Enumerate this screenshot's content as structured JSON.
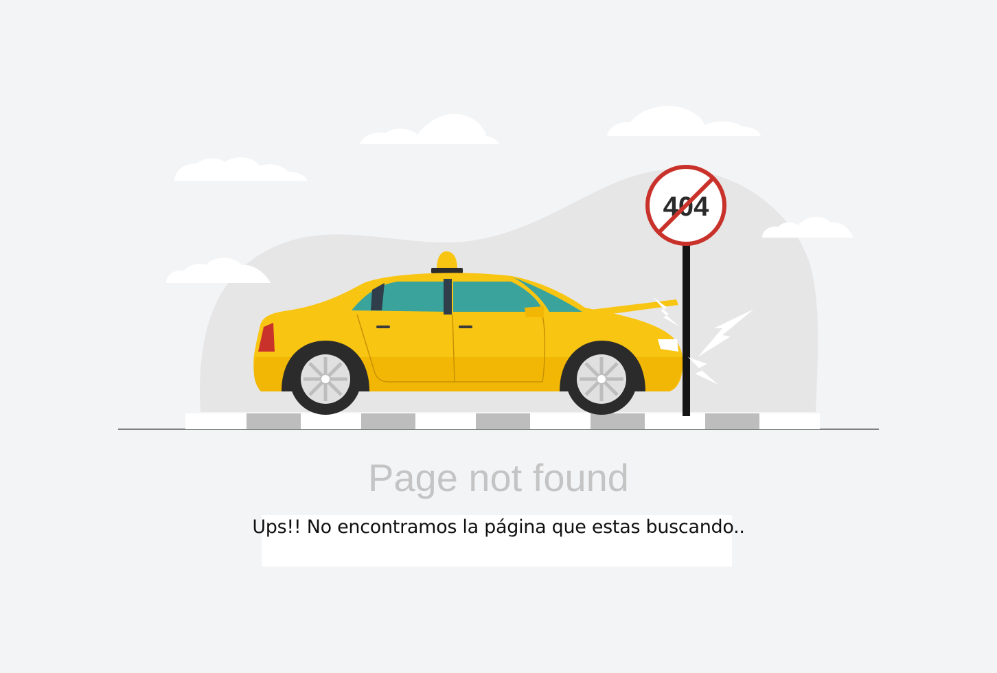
{
  "illustration": {
    "sign_text": "404",
    "colors": {
      "background": "#f3f4f6",
      "car_body": "#f9c513",
      "car_body_shade": "#f2b705",
      "window": "#3aa39b",
      "sign_ring": "#c9322b",
      "pole": "#151515",
      "hill": "#e6e6e7",
      "curb_dark": "#bdbdbd",
      "curb_light": "#ffffff"
    }
  },
  "content": {
    "title": "Page not found",
    "message": "Ups!! No encontramos la página que estas buscando.."
  }
}
